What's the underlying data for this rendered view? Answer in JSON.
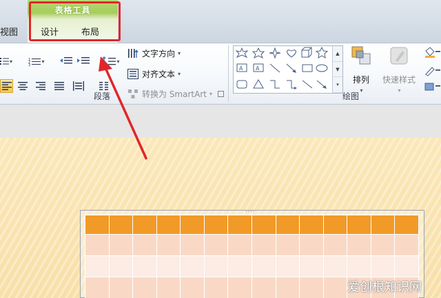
{
  "tabs": {
    "context_title": "表格工具",
    "view": "视图",
    "design": "设计",
    "layout": "布局"
  },
  "paragraph": {
    "text_direction": "文字方向",
    "align_text": "对齐文本",
    "convert_smartart": "转换为 SmartArt",
    "group_label": "段落"
  },
  "drawing": {
    "arrange": "排列",
    "quick_styles": "快速样式",
    "group_label": "绘图"
  },
  "table": {
    "columns": 14,
    "rows": 4
  },
  "colors": {
    "highlight": "#e0262a",
    "table_header": "#f19a28",
    "table_odd": "#f9d9c6",
    "table_even": "#fcece3",
    "context_tab": "#a6cd5c"
  },
  "watermark": "爱创根知识网"
}
